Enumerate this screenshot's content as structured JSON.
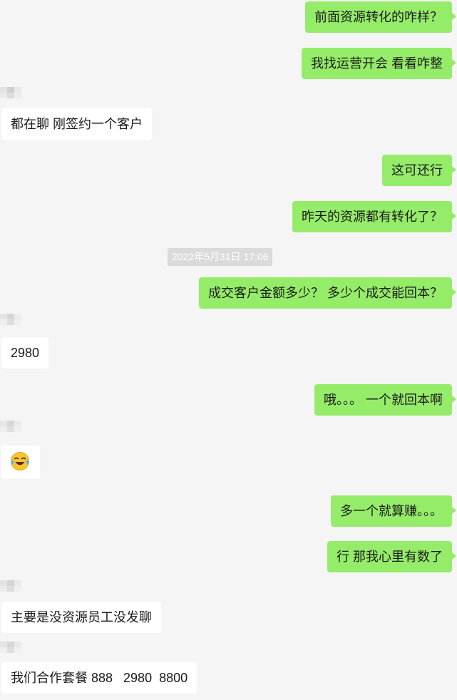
{
  "timestamp": "2022年5月31日 17:06",
  "messages": [
    {
      "id": "m1",
      "text": "前面资源转化的咋样？"
    },
    {
      "id": "m2",
      "text": "我找运营开会 看看咋整"
    },
    {
      "id": "m3",
      "text": "都在聊 刚签约一个客户"
    },
    {
      "id": "m4",
      "text": "这可还行"
    },
    {
      "id": "m5",
      "text": "昨天的资源都有转化了？"
    },
    {
      "id": "m6",
      "text": "成交客户金额多少？ 多少个成交能回本？"
    },
    {
      "id": "m7",
      "text": "2980"
    },
    {
      "id": "m8",
      "text": "哦。。。 一个就回本啊"
    },
    {
      "id": "m9",
      "text": "laughing-crying-emoji"
    },
    {
      "id": "m10",
      "text": "多一个就算赚。。。"
    },
    {
      "id": "m11",
      "text": "行 那我心里有数了"
    },
    {
      "id": "m12",
      "text": "主要是没资源员工没发聊"
    },
    {
      "id": "m13",
      "text": "我们合作套餐 888   2980  8800"
    }
  ],
  "colors": {
    "background": "#f5f5f5",
    "outgoing_bubble": "#95ec69",
    "incoming_bubble": "#ffffff",
    "timestamp_bg": "#dadada"
  }
}
